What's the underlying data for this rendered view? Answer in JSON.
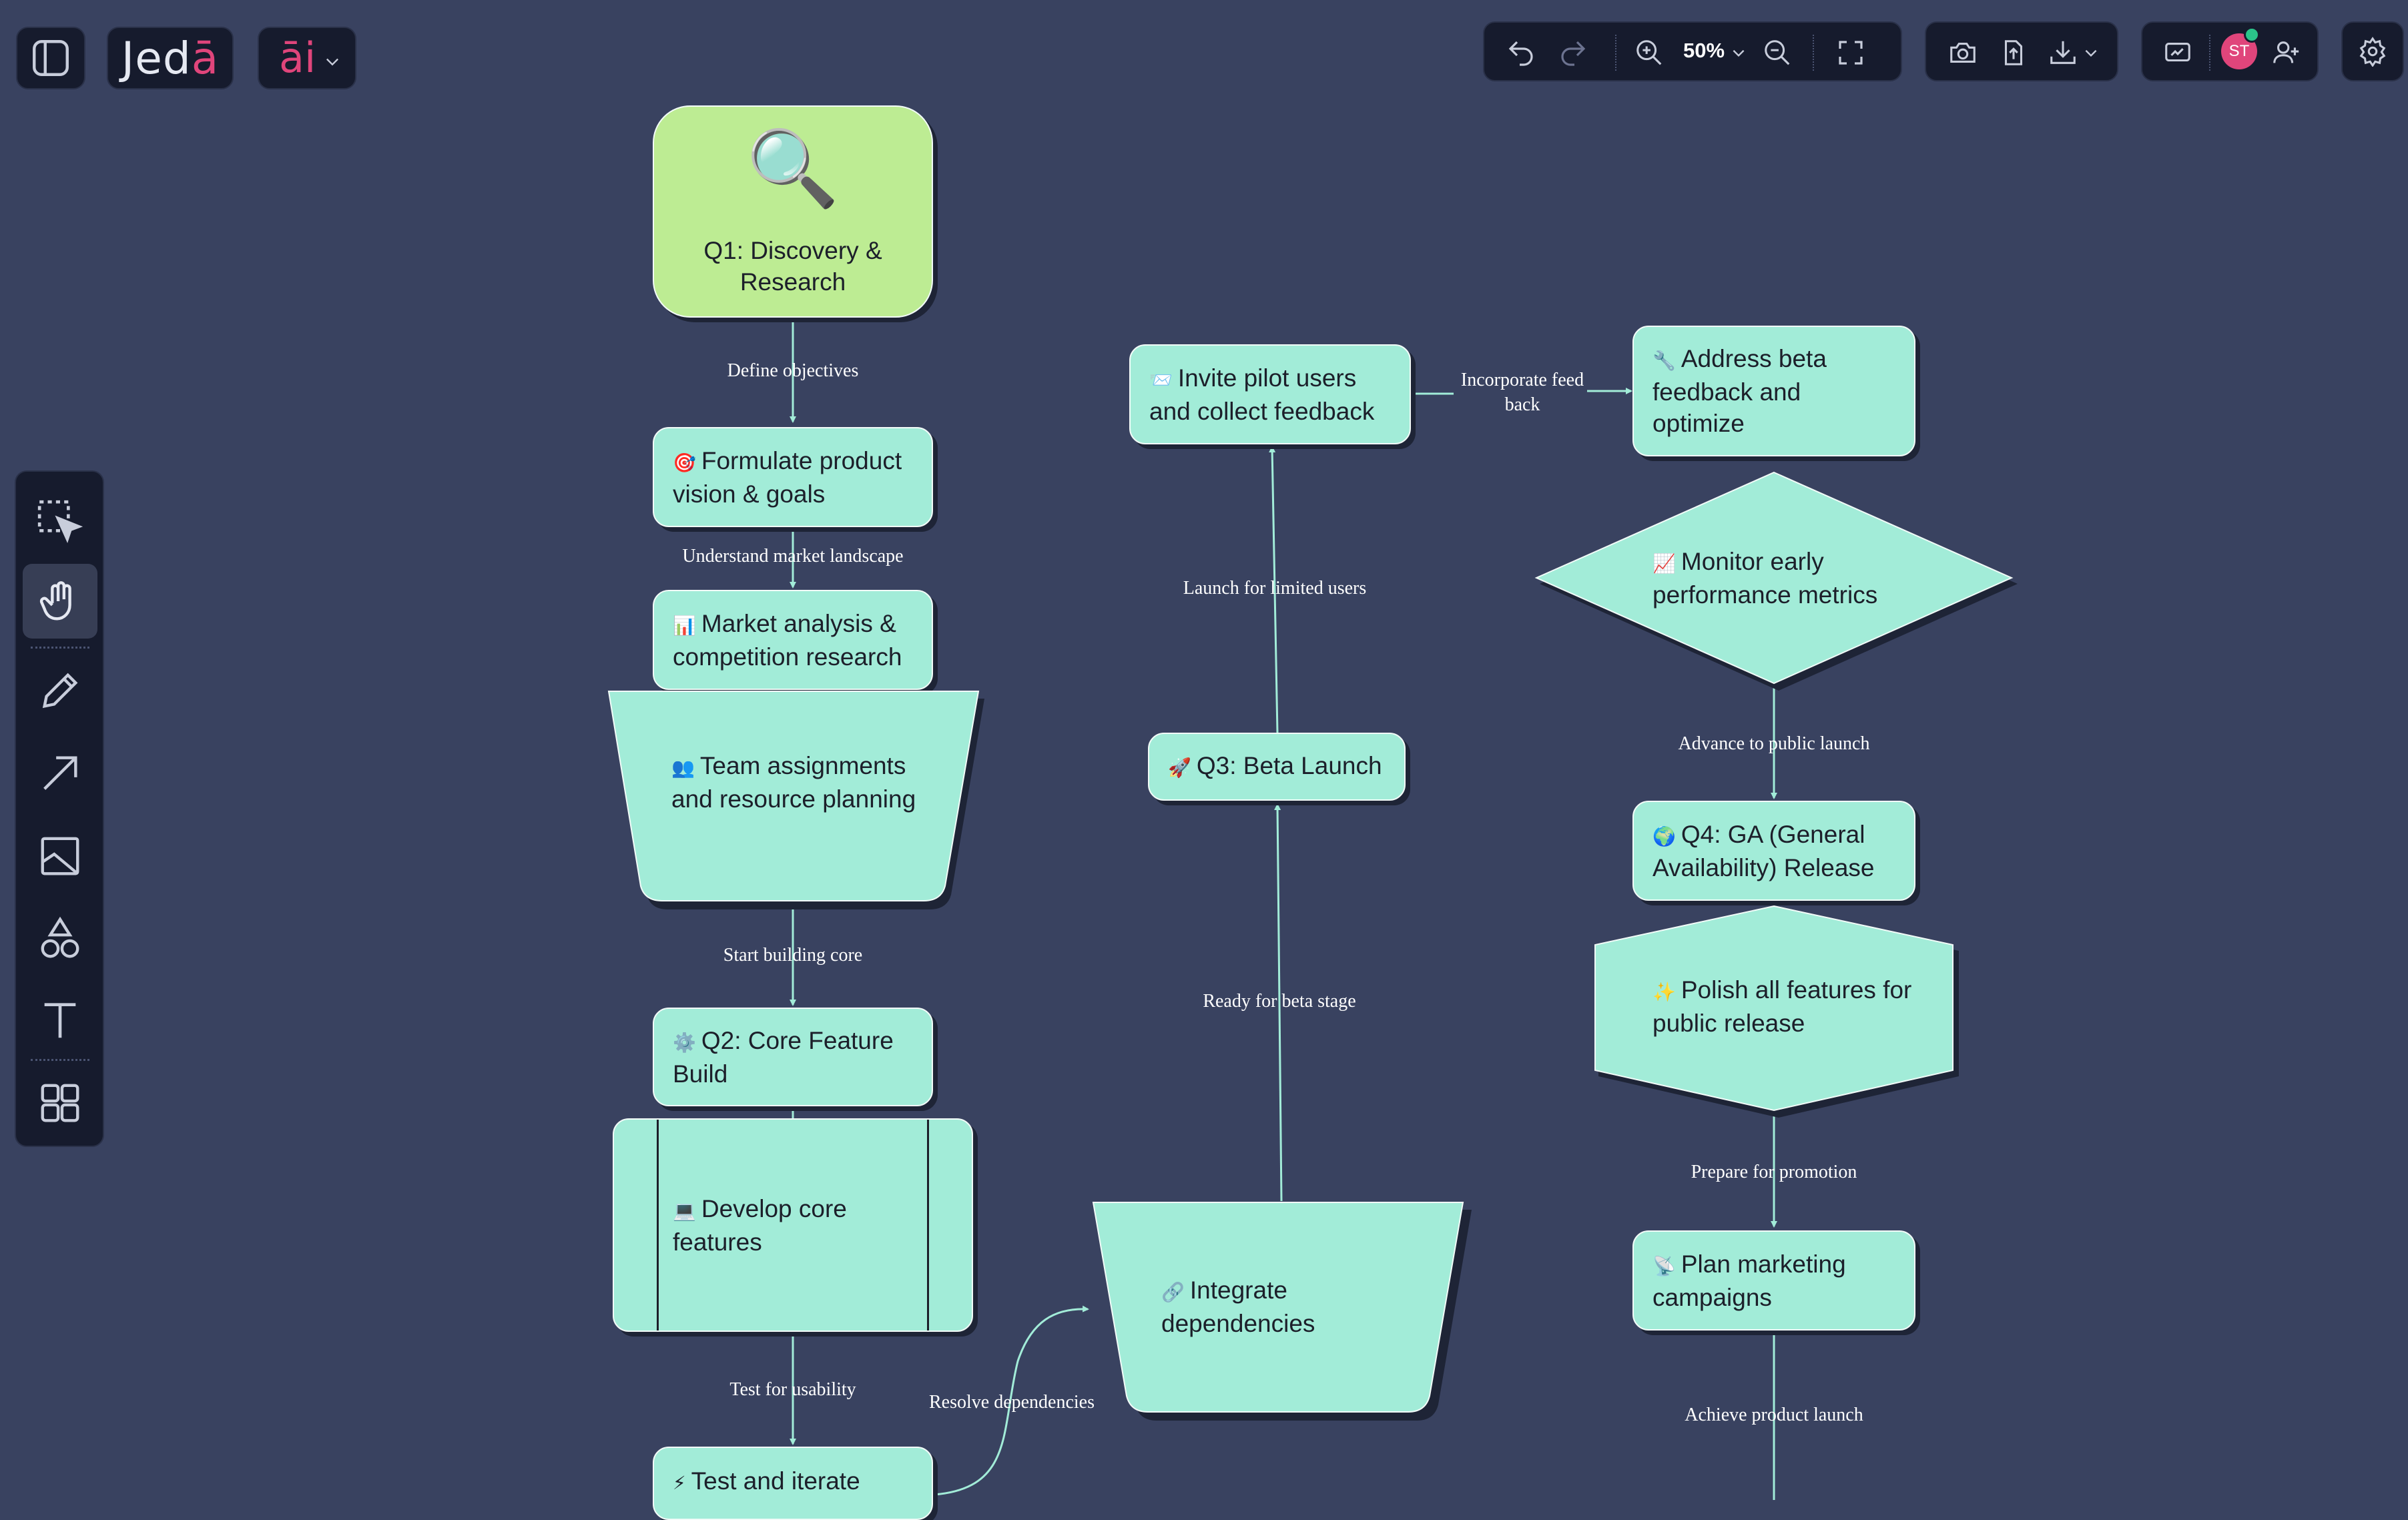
{
  "app": {
    "logo_prefix": "Jed",
    "logo_accent": "ā",
    "ai_label": "āi",
    "zoom": "50%",
    "avatar_initials": "ST",
    "colors": {
      "background": "#394260",
      "toolbar": "#161b2d",
      "node_fill": "#a2ecd8",
      "start_fill": "#bdec93",
      "brand_accent": "#e0457b",
      "edge": "#a2ecd8"
    }
  },
  "toolbar": {
    "icons": [
      "sidebar-toggle-icon",
      "undo-icon",
      "redo-icon",
      "zoom-in-icon",
      "chevron-down-icon",
      "zoom-out-icon",
      "fit-screen-icon",
      "camera-icon",
      "upload-icon",
      "download-icon",
      "present-icon",
      "add-user-icon",
      "gear-icon"
    ]
  },
  "left_tools": [
    "select-tool",
    "hand-tool",
    "pencil-tool",
    "arrow-tool",
    "image-tool",
    "shapes-tool",
    "text-tool",
    "templates-tool"
  ],
  "flowchart": {
    "nodes": {
      "q1": {
        "emoji": "🔍",
        "text": "Q1: Discovery & Research"
      },
      "vision": {
        "emoji": "🎯",
        "text": "Formulate product vision & goals"
      },
      "market": {
        "emoji": "📊",
        "text": "Market analysis & competition research"
      },
      "team": {
        "emoji": "👥",
        "text": "Team assignments and resource planning"
      },
      "q2": {
        "emoji": "⚙️",
        "text": "Q2: Core Feature Build"
      },
      "develop": {
        "emoji": "💻",
        "text": "Develop core features"
      },
      "test": {
        "emoji": "⚡",
        "text": "Test and iterate"
      },
      "integrate": {
        "emoji": "🔗",
        "text": "Integrate dependencies"
      },
      "q3": {
        "emoji": "🚀",
        "text": "Q3: Beta Launch"
      },
      "pilot": {
        "emoji": "📨",
        "text": "Invite pilot users and collect feedback"
      },
      "address": {
        "emoji": "🔧",
        "text": "Address beta feedback and optimize"
      },
      "monitor": {
        "emoji": "📈",
        "text": "Monitor early performance metrics"
      },
      "q4": {
        "emoji": "🌍",
        "text": "Q4: GA (General Availability) Release"
      },
      "polish": {
        "emoji": "✨",
        "text": "Polish all features for public release"
      },
      "marketing": {
        "emoji": "📡",
        "text": "Plan marketing campaigns"
      }
    },
    "edges": {
      "define": "Define objectives",
      "understand": "Understand market landscape",
      "start_core": "Start building core",
      "usability": "Test for usability",
      "resolve": "Resolve dependencies",
      "beta_stage": "Ready for beta stage",
      "limited": "Launch for limited users",
      "feedback_1": "Incorporate feed",
      "feedback_2": "back",
      "public": "Advance to public launch",
      "promotion": "Prepare for promotion",
      "achieve": "Achieve product launch"
    }
  }
}
